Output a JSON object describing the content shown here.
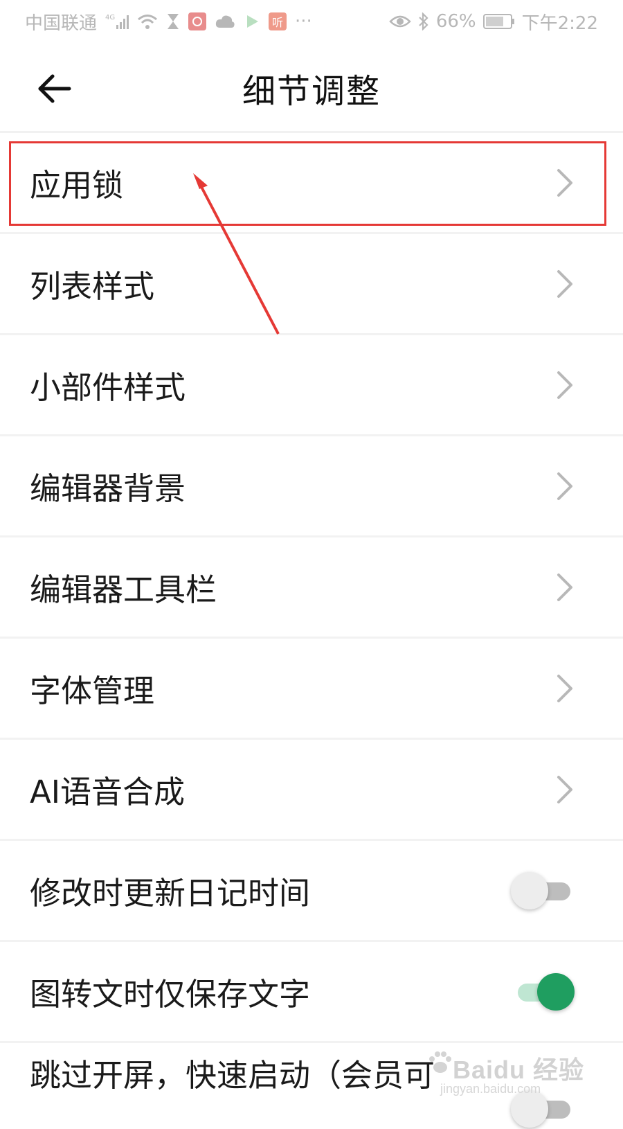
{
  "status_bar": {
    "carrier": "中国联通",
    "network": "4G",
    "battery_percent": "66%",
    "time": "下午2:22",
    "more": "···",
    "icons": [
      "signal-icon",
      "wifi-icon",
      "hourglass-icon",
      "app-icon",
      "cloud-icon",
      "play-icon",
      "ting-icon",
      "eye-icon",
      "bluetooth-icon",
      "battery-icon"
    ],
    "ting_label": "听"
  },
  "header": {
    "title": "细节调整",
    "back_icon": "arrow-left-icon"
  },
  "settings": {
    "items": [
      {
        "label": "应用锁",
        "control": "chevron"
      },
      {
        "label": "列表样式",
        "control": "chevron"
      },
      {
        "label": "小部件样式",
        "control": "chevron"
      },
      {
        "label": "编辑器背景",
        "control": "chevron"
      },
      {
        "label": "编辑器工具栏",
        "control": "chevron"
      },
      {
        "label": "字体管理",
        "control": "chevron"
      },
      {
        "label": "AI语音合成",
        "control": "chevron"
      },
      {
        "label": "修改时更新日记时间",
        "control": "toggle",
        "enabled": false
      },
      {
        "label": "图转文时仅保存文字",
        "control": "toggle",
        "enabled": true
      },
      {
        "label": "跳过开屏，快速启动（会员可",
        "control": "toggle",
        "enabled": false
      }
    ]
  },
  "annotation": {
    "highlighted_item": "应用锁",
    "color": "#e53935"
  },
  "watermark": {
    "brand": "Baidu 经验",
    "url": "jingyan.baidu.com"
  },
  "colors": {
    "accent_green": "#1f9e60",
    "toggle_on_track": "#bfe6d2",
    "toggle_off_track": "#bdbdbd",
    "divider": "#f2f2f2"
  }
}
